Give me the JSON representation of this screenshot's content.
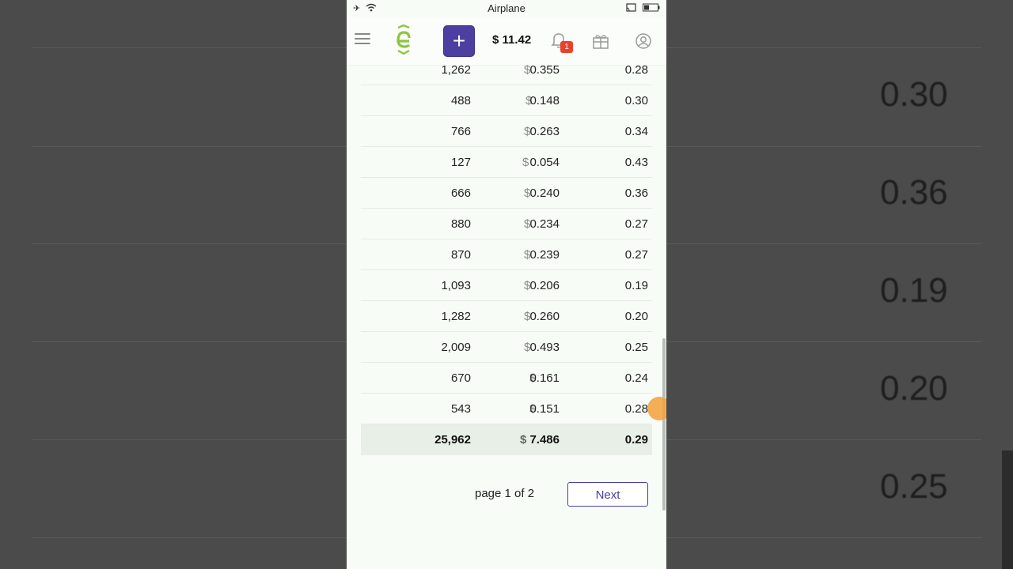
{
  "status_bar": {
    "carrier": "Airplane"
  },
  "app_bar": {
    "balance": "$ 11.42",
    "notification_count": "1",
    "add_label": "+"
  },
  "table": {
    "currency_symbol": "$",
    "rows": [
      {
        "count": "1,262",
        "cost": "0.355",
        "rate": "0.28"
      },
      {
        "count": "488",
        "cost": "0.148",
        "rate": "0.30"
      },
      {
        "count": "766",
        "cost": "0.263",
        "rate": "0.34"
      },
      {
        "count": "127",
        "cost": "0.054",
        "rate": "0.43"
      },
      {
        "count": "666",
        "cost": "0.240",
        "rate": "0.36"
      },
      {
        "count": "880",
        "cost": "0.234",
        "rate": "0.27"
      },
      {
        "count": "870",
        "cost": "0.239",
        "rate": "0.27"
      },
      {
        "count": "1,093",
        "cost": "0.206",
        "rate": "0.19"
      },
      {
        "count": "1,282",
        "cost": "0.260",
        "rate": "0.20"
      },
      {
        "count": "2,009",
        "cost": "0.493",
        "rate": "0.25"
      },
      {
        "count": "670",
        "cost": "0.161",
        "rate": "0.24"
      },
      {
        "count": "543",
        "cost": "0.151",
        "rate": "0.28"
      }
    ],
    "total": {
      "count": "25,962",
      "cost": "7.486",
      "rate": "0.29"
    }
  },
  "pagination": {
    "text": "page 1 of 2",
    "next_label": "Next"
  },
  "colors": {
    "accent": "#4b3fa0",
    "logo": "#8cc63f",
    "badge": "#e8412c"
  }
}
